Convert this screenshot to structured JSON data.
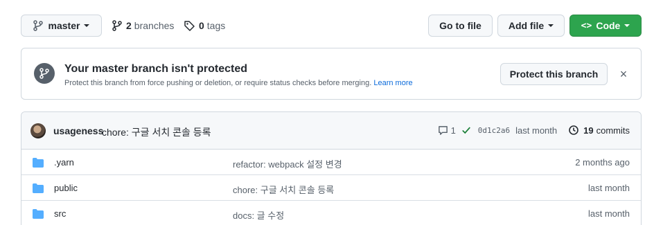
{
  "toolbar": {
    "branch_label": "master",
    "branches_count": "2",
    "branches_label": "branches",
    "tags_count": "0",
    "tags_label": "tags",
    "goto_label": "Go to file",
    "addfile_label": "Add file",
    "code_label": "Code",
    "code_glyph": "<>"
  },
  "protect": {
    "title": "Your master branch isn't protected",
    "description": "Protect this branch from force pushing or deletion, or require status checks before merging.",
    "learn_more": "Learn more",
    "button_label": "Protect this branch",
    "dismiss_glyph": "×"
  },
  "commit": {
    "author": "usageness",
    "message": "chore: 구글 서치 콘솔 등록",
    "comments": "1",
    "sha": "0d1c2a6",
    "time": "last month",
    "commits_count": "19",
    "commits_label": "commits"
  },
  "files": [
    {
      "name": ".yarn",
      "message": "refactor: webpack 설정 변경",
      "time": "2 months ago"
    },
    {
      "name": "public",
      "message": "chore: 구글 서치 콘솔 등록",
      "time": "last month"
    },
    {
      "name": "src",
      "message": "docs: 글 수정",
      "time": "last month"
    }
  ],
  "colors": {
    "code_button": "#2da44e",
    "folder": "#54aeff",
    "link": "#0969da",
    "check": "#1a7f37"
  }
}
